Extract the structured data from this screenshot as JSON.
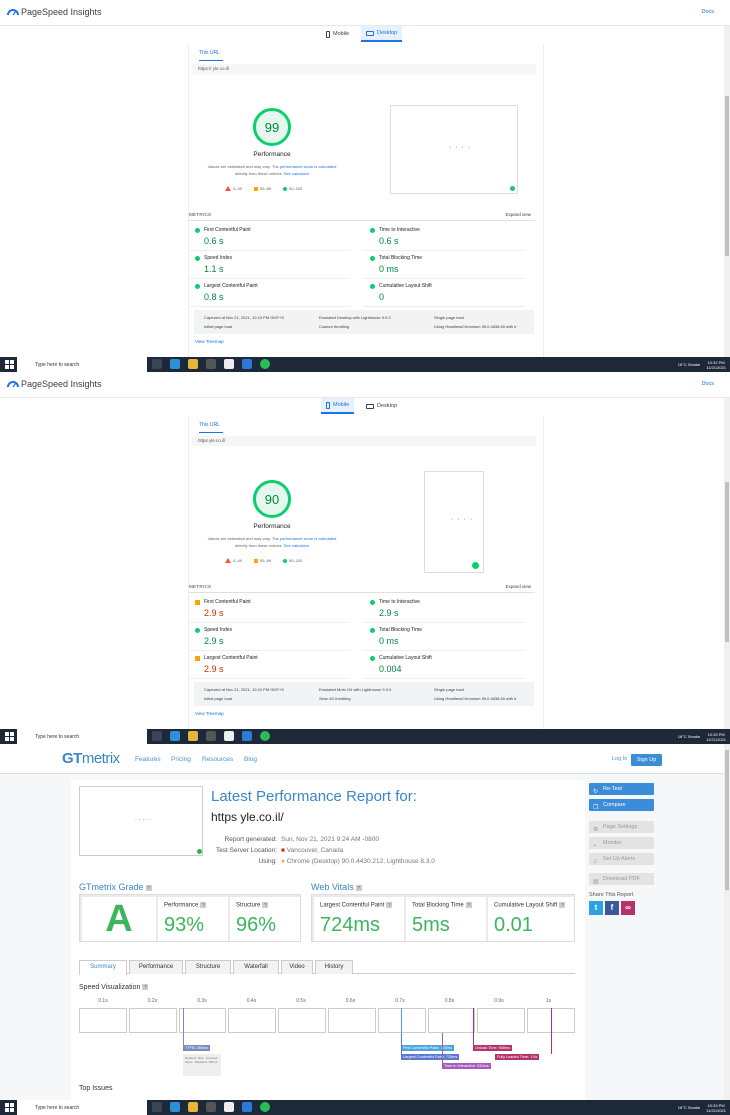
{
  "panel1": {
    "app_title": "PageSpeed Insights",
    "docs": "Docs",
    "mobile": "Mobile",
    "desktop": "Desktop",
    "tab": "This URL",
    "url": "https://          yle.co.il/",
    "score": "99",
    "perf_label": "Performance",
    "est_1": "Values are estimated and may vary. The ",
    "est_link": "performance score is calculated",
    "est_2": "directly from these metrics. ",
    "est_calc": "See calculator",
    "leg_red": "0–49",
    "leg_orange": "50–89",
    "leg_green": "90–100",
    "metrics_head": "METRICS",
    "expand": "Expand view",
    "fcp_l": "First Contentful Paint",
    "fcp_v": "0.6 s",
    "tti_l": "Time to Interactive",
    "tti_v": "0.6 s",
    "si_l": "Speed Index",
    "si_v": "1.1 s",
    "tbt_l": "Total Blocking Time",
    "tbt_v": "0 ms",
    "lcp_l": "Largest Contentful Paint",
    "lcp_v": "0.8 s",
    "cls_l": "Cumulative Layout Shift",
    "cls_v": "0",
    "info_captured": "Captured at Nov 21, 2021, 10:24 PM GMT+5",
    "info_emulated": "Emulated Desktop with Lighthouse 9.0.0",
    "info_single": "Single page load",
    "info_initial": "Initial page load",
    "info_throttle": "Custom throttling",
    "info_chrome": "Using HeadlessChromium 95.0.4638.69 with lr",
    "treemap": "View Treemap"
  },
  "panel2": {
    "app_title": "PageSpeed Insights",
    "docs": "Docs",
    "mobile": "Mobile",
    "desktop": "Desktop",
    "tab": "This URL",
    "url": "https             yle.co.il/",
    "score": "90",
    "perf_label": "Performance",
    "est_1": "Values are estimated and may vary. The ",
    "est_link": "performance score is calculated",
    "est_2": "directly from these metrics. ",
    "est_calc": "See calculator",
    "leg_red": "0–49",
    "leg_orange": "50–89",
    "leg_green": "90–100",
    "metrics_head": "METRICS",
    "expand": "Expand view",
    "fcp_l": "First Contentful Paint",
    "fcp_v": "2.9 s",
    "tti_l": "Time to Interactive",
    "tti_v": "2.9 s",
    "si_l": "Speed Index",
    "si_v": "2.9 s",
    "tbt_l": "Total Blocking Time",
    "tbt_v": "0 ms",
    "lcp_l": "Largest Contentful Paint",
    "lcp_v": "2.9 s",
    "cls_l": "Cumulative Layout Shift",
    "cls_v": "0.004",
    "info_captured": "Captured at Nov 21, 2021, 10:24 PM GMT+5",
    "info_emulated": "Emulated Moto G4 with Lighthouse 9.0.0",
    "info_single": "Single page load",
    "info_initial": "Initial page load",
    "info_throttle": "Slow 4G throttling",
    "info_chrome": "Using HeadlessChromium 95.0.4638.69 with lr",
    "treemap": "View Treemap"
  },
  "taskbar": {
    "search": "Type here to search",
    "weather": "16°C  Smoke",
    "time1": "10:32 PM",
    "time2": "10:33 PM",
    "time3": "10:33 PM",
    "date": "11/21/2021"
  },
  "gtmetrix": {
    "logo_a": "GT",
    "logo_b": "metrix",
    "nav": [
      "Features",
      "Pricing",
      "Resources",
      "Blog"
    ],
    "login": "Log In",
    "signup": "Sign Up",
    "title": "Latest Performance Report for:",
    "url": "https                   yle.co.il/",
    "report_k": "Report generated:",
    "report_v": "Sun, Nov 21, 2021 9:24 AM -0800",
    "server_k": "Test Server Location:",
    "server_v": "Vancouver, Canada",
    "using_k": "Using:",
    "using_v": "Chrome (Desktop) 90.0.4430.212, Lighthouse 8.3.0",
    "grade_title": "GTmetrix Grade",
    "grade": "A",
    "perf_l": "Performance",
    "perf_v": "93%",
    "struct_l": "Structure",
    "struct_v": "96%",
    "vitals_title": "Web Vitals",
    "lcp_l": "Largest Contentful Paint",
    "lcp_v": "724ms",
    "tbt_l": "Total Blocking Time",
    "tbt_v": "5ms",
    "cls_l": "Cumulative Layout Shift",
    "cls_v": "0.01",
    "tabs": [
      "Summary",
      "Performance",
      "Structure",
      "Waterfall",
      "Video",
      "History"
    ],
    "sv_title": "Speed Visualization",
    "ticks": [
      "0.1s",
      "0.2s",
      "0.3s",
      "0.4s",
      "0.5s",
      "0.6s",
      "0.7s",
      "0.8s",
      "0.9s",
      "1s"
    ],
    "ttfb": "TTFB: 268ms",
    "ttfb_sub": "Redirect: 0ms · Connect: 61ms · Backend: 187ms",
    "m_fcp": "First Contentful Paint: 725ms",
    "m_lcp": "Largest Contentful Paint: 725ms",
    "m_tti": "Time to Interactive: 810ms",
    "m_onload": "Onload Time: 985ms",
    "m_full": "Fully Loaded Time: 1.0s",
    "top_issues": "Top Issues",
    "side": [
      "Re-Test",
      "Compare",
      "Page Settings",
      "Monitor",
      "Set Up Alerts",
      "Download PDF"
    ],
    "share": "Share This Report"
  },
  "colors": {
    "pass": "#0cce6b",
    "average": "#ffa400",
    "fail": "#ff4e42",
    "gt_blue": "#3b86c8",
    "gt_green": "#3db55b"
  }
}
